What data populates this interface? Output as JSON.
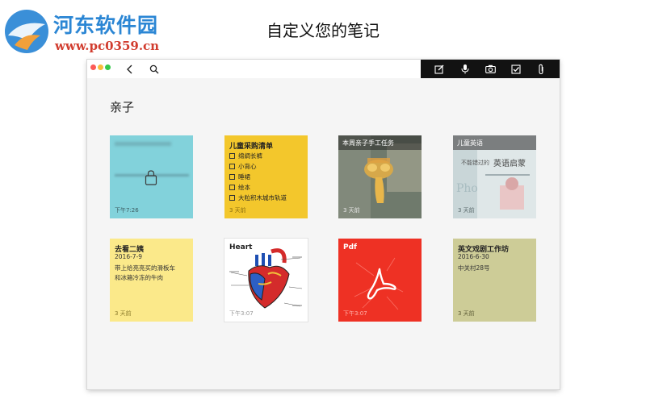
{
  "watermark": {
    "name": "河东软件园",
    "url": "www.pc0359.cn"
  },
  "headline": "自定义您的笔记",
  "window": {
    "section_title": "亲子",
    "toolbar_icons": [
      "edit-icon",
      "microphone-icon",
      "camera-icon",
      "checkbox-icon",
      "attachment-icon"
    ]
  },
  "notes": [
    {
      "type": "locked",
      "time": "下午7:26",
      "color": "#7fd3dc"
    },
    {
      "type": "checklist",
      "title": "儿童采购清单",
      "items": [
        "绵绸长裤",
        "小背心",
        "睡裙",
        "绘本",
        "大粒积木城市轨道"
      ],
      "time": "3 天前",
      "color": "#f3c72c"
    },
    {
      "type": "photo",
      "title": "本周亲子手工任务",
      "time": "3 天前"
    },
    {
      "type": "photo",
      "title": "儿童英语",
      "time": "3 天前",
      "book_title": "英语启蒙",
      "book_side": "不能错过的"
    },
    {
      "type": "text",
      "title": "去看二姨",
      "date": "2016-7-9",
      "lines": [
        "带上给亮亮买的滑板车",
        "和冰箱冷冻的牛肉"
      ],
      "time": "3 天前",
      "color": "#fbe98a"
    },
    {
      "type": "drawing",
      "title": "Heart",
      "time": "下午3:07",
      "color": "#ffffff"
    },
    {
      "type": "pdf",
      "title": "Pdf",
      "time": "下午3:07",
      "color": "#ee3124"
    },
    {
      "type": "text",
      "title": "英文戏剧工作坊",
      "date": "2016-6-30",
      "lines": [
        "中关村28号"
      ],
      "time": "3 天前",
      "color": "#cdcc97"
    }
  ]
}
